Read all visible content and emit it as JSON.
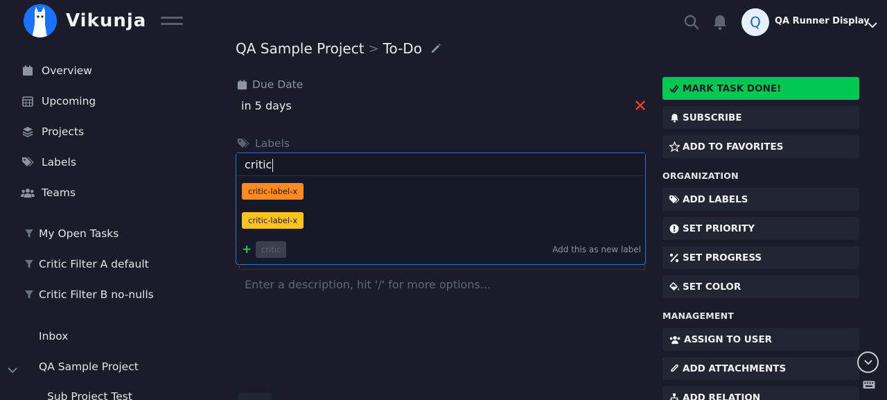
{
  "app": {
    "name": "Vikunja"
  },
  "user": {
    "initial": "Q",
    "name": "QA Runner Display"
  },
  "sidebar": {
    "nav": [
      {
        "label": "Overview",
        "icon": "calendar-icon"
      },
      {
        "label": "Upcoming",
        "icon": "calendar-grid-icon"
      },
      {
        "label": "Projects",
        "icon": "layers-icon"
      },
      {
        "label": "Labels",
        "icon": "tags-icon"
      },
      {
        "label": "Teams",
        "icon": "users-icon"
      }
    ],
    "filters": [
      {
        "label": "My Open Tasks"
      },
      {
        "label": "Critic Filter A default"
      },
      {
        "label": "Critic Filter B no-nulls"
      }
    ],
    "projects": [
      {
        "label": "Inbox"
      },
      {
        "label": "QA Sample Project"
      },
      {
        "label": "Sub Project Test"
      }
    ]
  },
  "breadcrumb": {
    "project": "QA Sample Project",
    "separator": ">",
    "task": "To-Do"
  },
  "due_date": {
    "label": "Due Date",
    "value": "in 5 days"
  },
  "labels": {
    "label": "Labels",
    "input_value": "critic",
    "results": [
      {
        "text": "critic-label-x",
        "color": "#ff8a1f"
      },
      {
        "text": "critic-label-x",
        "color": "#ffc31f"
      }
    ],
    "new_label_text": "critic",
    "new_label_hint": "Add this as new label"
  },
  "description": {
    "placeholder": "Enter a description, hit '/' for more options..."
  },
  "actions": {
    "mark_done": "MARK TASK DONE!",
    "subscribe": "SUBSCRIBE",
    "favorite": "ADD TO FAVORITES",
    "organization": "ORGANIZATION",
    "add_labels": "ADD LABELS",
    "set_priority": "SET PRIORITY",
    "set_progress": "SET PROGRESS",
    "set_color": "SET COLOR",
    "management": "MANAGEMENT",
    "assign_user": "ASSIGN TO USER",
    "add_attachments": "ADD ATTACHMENTS",
    "add_relation": "ADD RELATION"
  },
  "colors": {
    "background": "#1a1d29",
    "primary": "#00c853",
    "accent": "#1973ff",
    "danger": "#ff3b30"
  }
}
